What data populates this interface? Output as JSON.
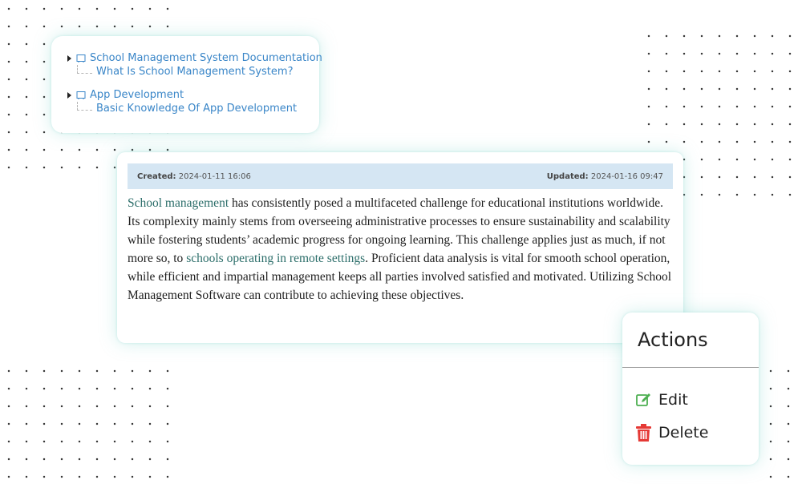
{
  "tree": {
    "nodes": [
      {
        "label": "School Management System Documentation",
        "child": "What Is School Management System?"
      },
      {
        "label": "App Development",
        "child": "Basic Knowledge Of App Development"
      }
    ]
  },
  "article": {
    "created_label": "Created:",
    "created_value": "2024-01-11 16:06",
    "updated_label": "Updated:",
    "updated_value": "2024-01-16 09:47",
    "segments": {
      "link1": "School management",
      "text1": " has consistently posed a multifaceted challenge for educational institutions worldwide. Its complexity mainly stems from overseeing administrative processes to ensure sustainability and scalability while fostering students’ academic progress for ongoing learning. This challenge applies just as much, if not more so, to ",
      "link2": "schools operating in remote settings",
      "text2": ". Proficient data analysis is vital for smooth school operation, while efficient and impartial management keeps all parties involved satisfied and motivated. Utilizing School Management Software can contribute to achieving these objectives."
    },
    "link_color": "#2c6e6a"
  },
  "actions": {
    "title": "Actions",
    "items": [
      {
        "label": "Edit",
        "icon": "edit-icon",
        "color": "#4caf50"
      },
      {
        "label": "Delete",
        "icon": "trash-icon",
        "color": "#e53935"
      }
    ]
  }
}
